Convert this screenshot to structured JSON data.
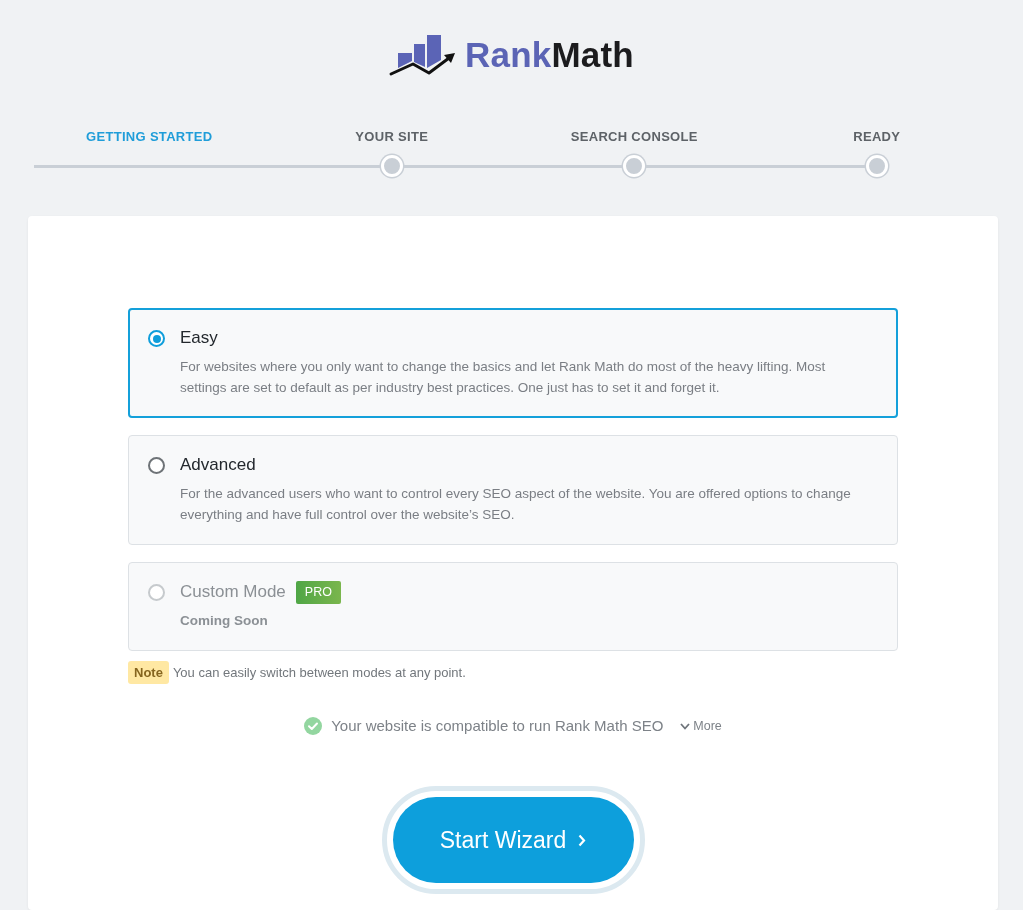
{
  "logo": {
    "words": [
      "Rank",
      "Math"
    ]
  },
  "steps": [
    {
      "label": "GETTING STARTED",
      "selected": true
    },
    {
      "label": "YOUR SITE",
      "selected": false
    },
    {
      "label": "SEARCH CONSOLE",
      "selected": false
    },
    {
      "label": "READY",
      "selected": false
    }
  ],
  "modes": [
    {
      "title": "Easy",
      "description": "For websites where you only want to change the basics and let Rank Math do most of the heavy lifting. Most settings are set to default as per industry best practices. One just has to set it and forget it.",
      "selected": true,
      "disabled": false
    },
    {
      "title": "Advanced",
      "description": "For the advanced users who want to control every SEO aspect of the website. You are offered options to change everything and have full control over the website’s SEO.",
      "selected": false,
      "disabled": false
    },
    {
      "title": "Custom Mode",
      "badge": "PRO",
      "subtitle": "Coming Soon",
      "selected": false,
      "disabled": true
    }
  ],
  "note": {
    "tag": "Note",
    "text": "You can easily switch between modes at any point."
  },
  "compatibility": {
    "text": "Your website is compatible to run Rank Math SEO",
    "toggle": "More"
  },
  "start_button": {
    "label": "Start Wizard"
  }
}
